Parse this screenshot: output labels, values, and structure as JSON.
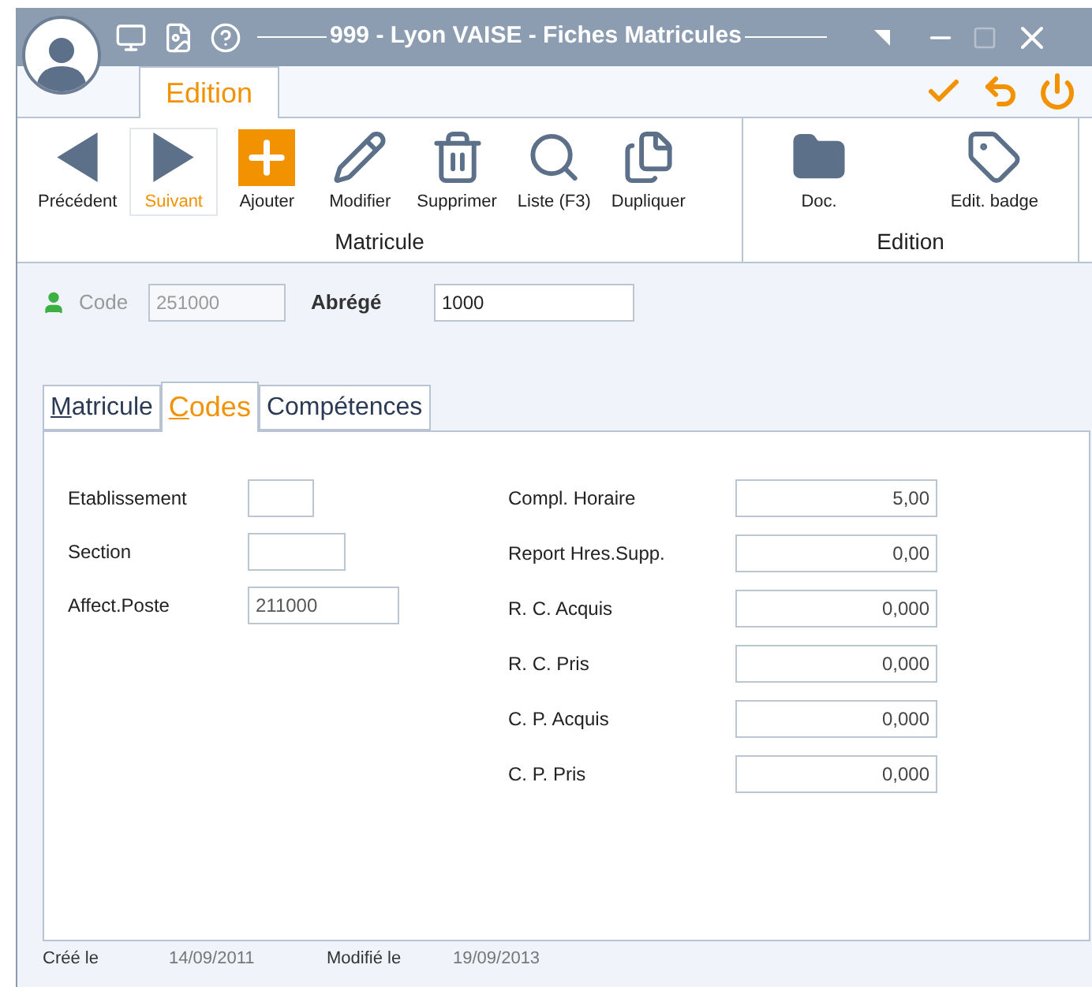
{
  "window": {
    "title": "999 - Lyon VAISE - Fiches Matricules"
  },
  "ribbon_tabs": [
    {
      "label": "Edition",
      "selected": true
    }
  ],
  "ribbon_groups": [
    {
      "label": "Matricule",
      "buttons": [
        {
          "kind": "prev",
          "label": "Précédent",
          "selected": false
        },
        {
          "kind": "next",
          "label": "Suivant",
          "selected": true
        },
        {
          "kind": "add",
          "label": "Ajouter",
          "selected": false
        },
        {
          "kind": "edit",
          "label": "Modifier",
          "selected": false
        },
        {
          "kind": "delete",
          "label": "Supprimer",
          "selected": false
        },
        {
          "kind": "search",
          "label": "Liste (F3)",
          "selected": false
        },
        {
          "kind": "copy",
          "label": "Dupliquer",
          "selected": false
        }
      ]
    },
    {
      "label": "Edition",
      "buttons": [
        {
          "kind": "folder",
          "label": "Doc.",
          "selected": false
        },
        {
          "kind": "badge",
          "label": "Edit. badge",
          "selected": false
        }
      ]
    }
  ],
  "header": {
    "code_label": "Code",
    "code_value": "251000",
    "code_disabled": true,
    "short_label": "Abrégé",
    "short_value": "1000"
  },
  "tabs": [
    {
      "label": "Matricule",
      "selected": false,
      "underline_first": true
    },
    {
      "label": "Codes",
      "selected": true,
      "underline_first": true
    },
    {
      "label": "Compétences",
      "selected": false,
      "underline_first": false
    }
  ],
  "left_fields": [
    {
      "label": "Etablissement"
    },
    {
      "label": "Section"
    },
    {
      "label": "Affect.Poste",
      "value": "211000"
    }
  ],
  "right_fields": [
    {
      "label": "Compl. Horaire",
      "value": "5,00"
    },
    {
      "label": "Report Hres.Supp.",
      "value": "0,00"
    },
    {
      "label": "R. C. Acquis",
      "value": "0,000"
    },
    {
      "label": "R. C. Pris",
      "value": "0,000"
    },
    {
      "label": "C. P. Acquis",
      "value": "0,000"
    },
    {
      "label": "C. P. Pris",
      "value": "0,000"
    }
  ],
  "footer": {
    "created_label": "Créé le",
    "created": "14/09/2011",
    "modified_label": "Modifié le",
    "modified": "19/09/2013"
  }
}
